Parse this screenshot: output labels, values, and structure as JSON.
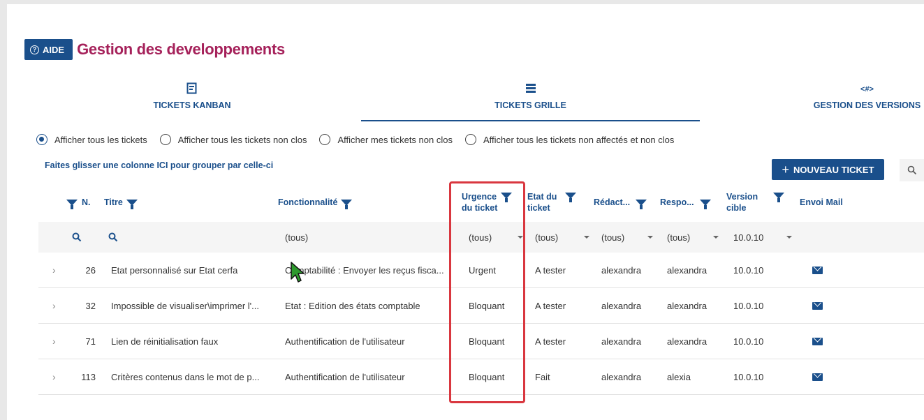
{
  "header": {
    "aide_label": "AIDE",
    "title": "Gestion des developpements"
  },
  "tabs": [
    {
      "label": "TICKETS KANBAN",
      "icon": "kanban-icon"
    },
    {
      "label": "TICKETS GRILLE",
      "icon": "grid-icon",
      "active": true
    },
    {
      "label": "GESTION DES VERSIONS",
      "icon": "versions-icon",
      "icon_text": "<#>"
    }
  ],
  "filters": [
    {
      "label": "Afficher tous les tickets",
      "checked": true
    },
    {
      "label": "Afficher tous les tickets non clos",
      "checked": false
    },
    {
      "label": "Afficher mes tickets non clos",
      "checked": false
    },
    {
      "label": "Afficher tous les tickets non affectés et non clos",
      "checked": false
    }
  ],
  "group_hint": "Faites glisser une colonne ICI pour grouper par celle-ci",
  "new_ticket_label": "NOUVEAU TICKET",
  "columns": {
    "num": "N.",
    "titre": "Titre",
    "fonctionnalite": "Fonctionnalité",
    "urgence_line1": "Urgence",
    "urgence_line2": "du ticket",
    "etat_line1": "Etat du",
    "etat_line2": "ticket",
    "redacteur": "Rédact...",
    "responsable": "Respo...",
    "version_line1": "Version",
    "version_line2": "cible",
    "envoi_mail": "Envoi Mail"
  },
  "filter_row": {
    "fonctionnalite": "(tous)",
    "urgence": "(tous)",
    "etat": "(tous)",
    "redacteur": "(tous)",
    "responsable": "(tous)",
    "version": "10.0.10"
  },
  "rows": [
    {
      "num": "26",
      "titre": "Etat personnalisé sur Etat cerfa",
      "fonctionnalite": "Comptabilité : Envoyer les reçus fisca...",
      "urgence": "Urgent",
      "etat": "A tester",
      "redacteur": "alexandra",
      "responsable": "alexandra",
      "version": "10.0.10"
    },
    {
      "num": "32",
      "titre": "Impossible de visualiser\\imprimer l'...",
      "fonctionnalite": "Etat : Edition des états comptable",
      "urgence": "Bloquant",
      "etat": "A tester",
      "redacteur": "alexandra",
      "responsable": "alexandra",
      "version": "10.0.10"
    },
    {
      "num": "71",
      "titre": "Lien de réinitialisation faux",
      "fonctionnalite": "Authentification de l'utilisateur",
      "urgence": "Bloquant",
      "etat": "A tester",
      "redacteur": "alexandra",
      "responsable": "alexandra",
      "version": "10.0.10"
    },
    {
      "num": "113",
      "titre": "Critères contenus dans le mot de p...",
      "fonctionnalite": "Authentification de l'utilisateur",
      "urgence": "Bloquant",
      "etat": "Fait",
      "redacteur": "alexandra",
      "responsable": "alexia",
      "version": "10.0.10"
    }
  ],
  "colors": {
    "primary": "#1a4f8b",
    "title": "#a5215a",
    "highlight": "#d9373f"
  }
}
